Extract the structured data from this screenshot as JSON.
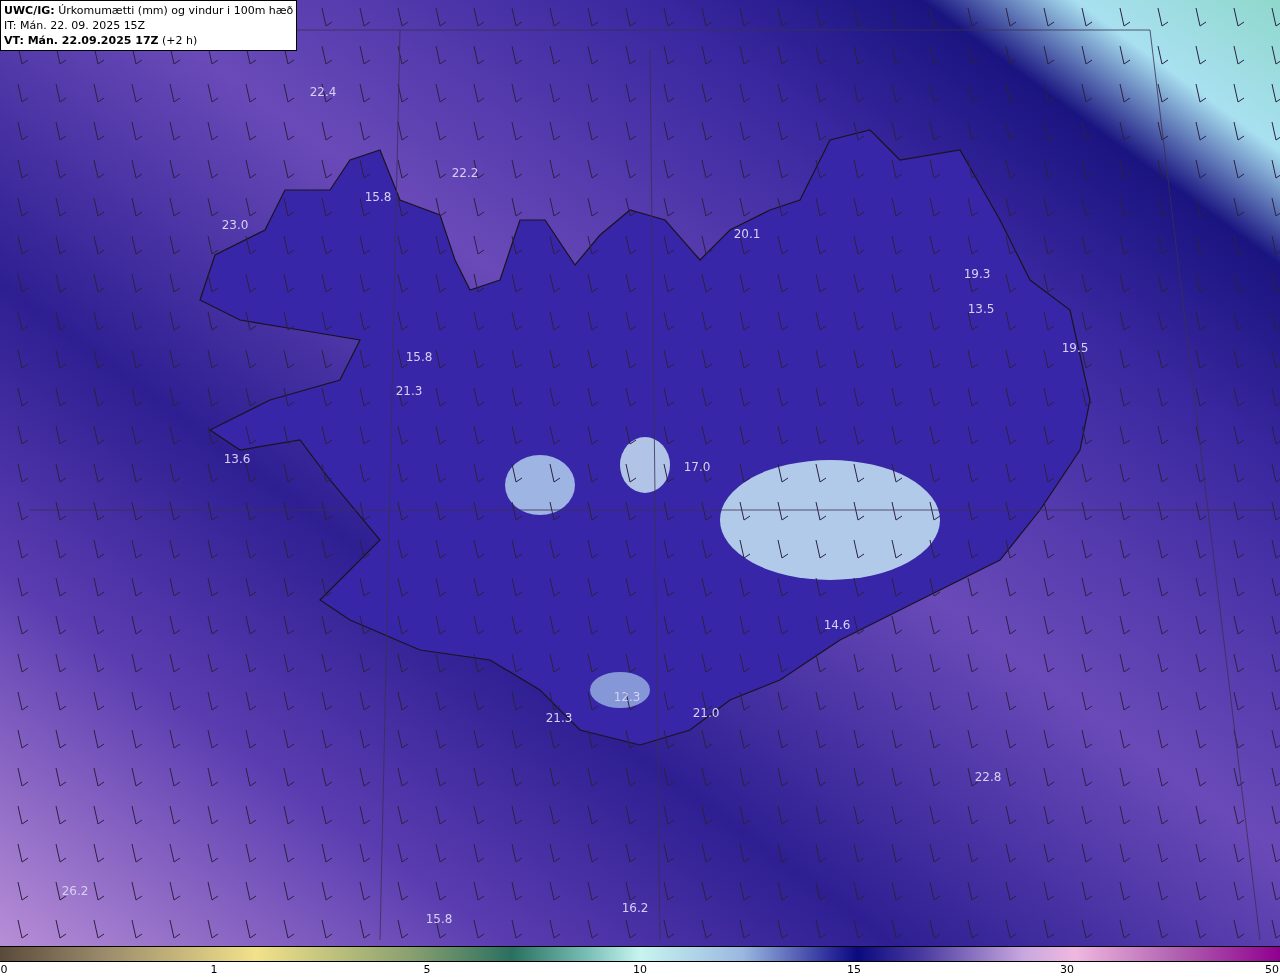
{
  "header": {
    "title": "**UWC/IG:** Úrkomumætti (mm) og vindur i 100m hæð",
    "issue_time": "IT: Mán. 22. 09. 2025 15Z",
    "valid_time": "**VT: Mán. 22.09.2025 17Z** (+2 h)"
  },
  "map_values": [
    "22.4",
    "22.2",
    "15.8",
    "23.0",
    "20.1",
    "19.3",
    "13.5",
    "19.5",
    "15.8",
    "21.3",
    "13.6",
    "17.0",
    "14.6",
    "12.3",
    "21.3",
    "21.0",
    "22.8",
    "26.2",
    "16.2",
    "15.8"
  ],
  "colorbar": {
    "ticks": [
      "0",
      "1",
      "5",
      "10",
      "15",
      "30",
      "50"
    ]
  }
}
